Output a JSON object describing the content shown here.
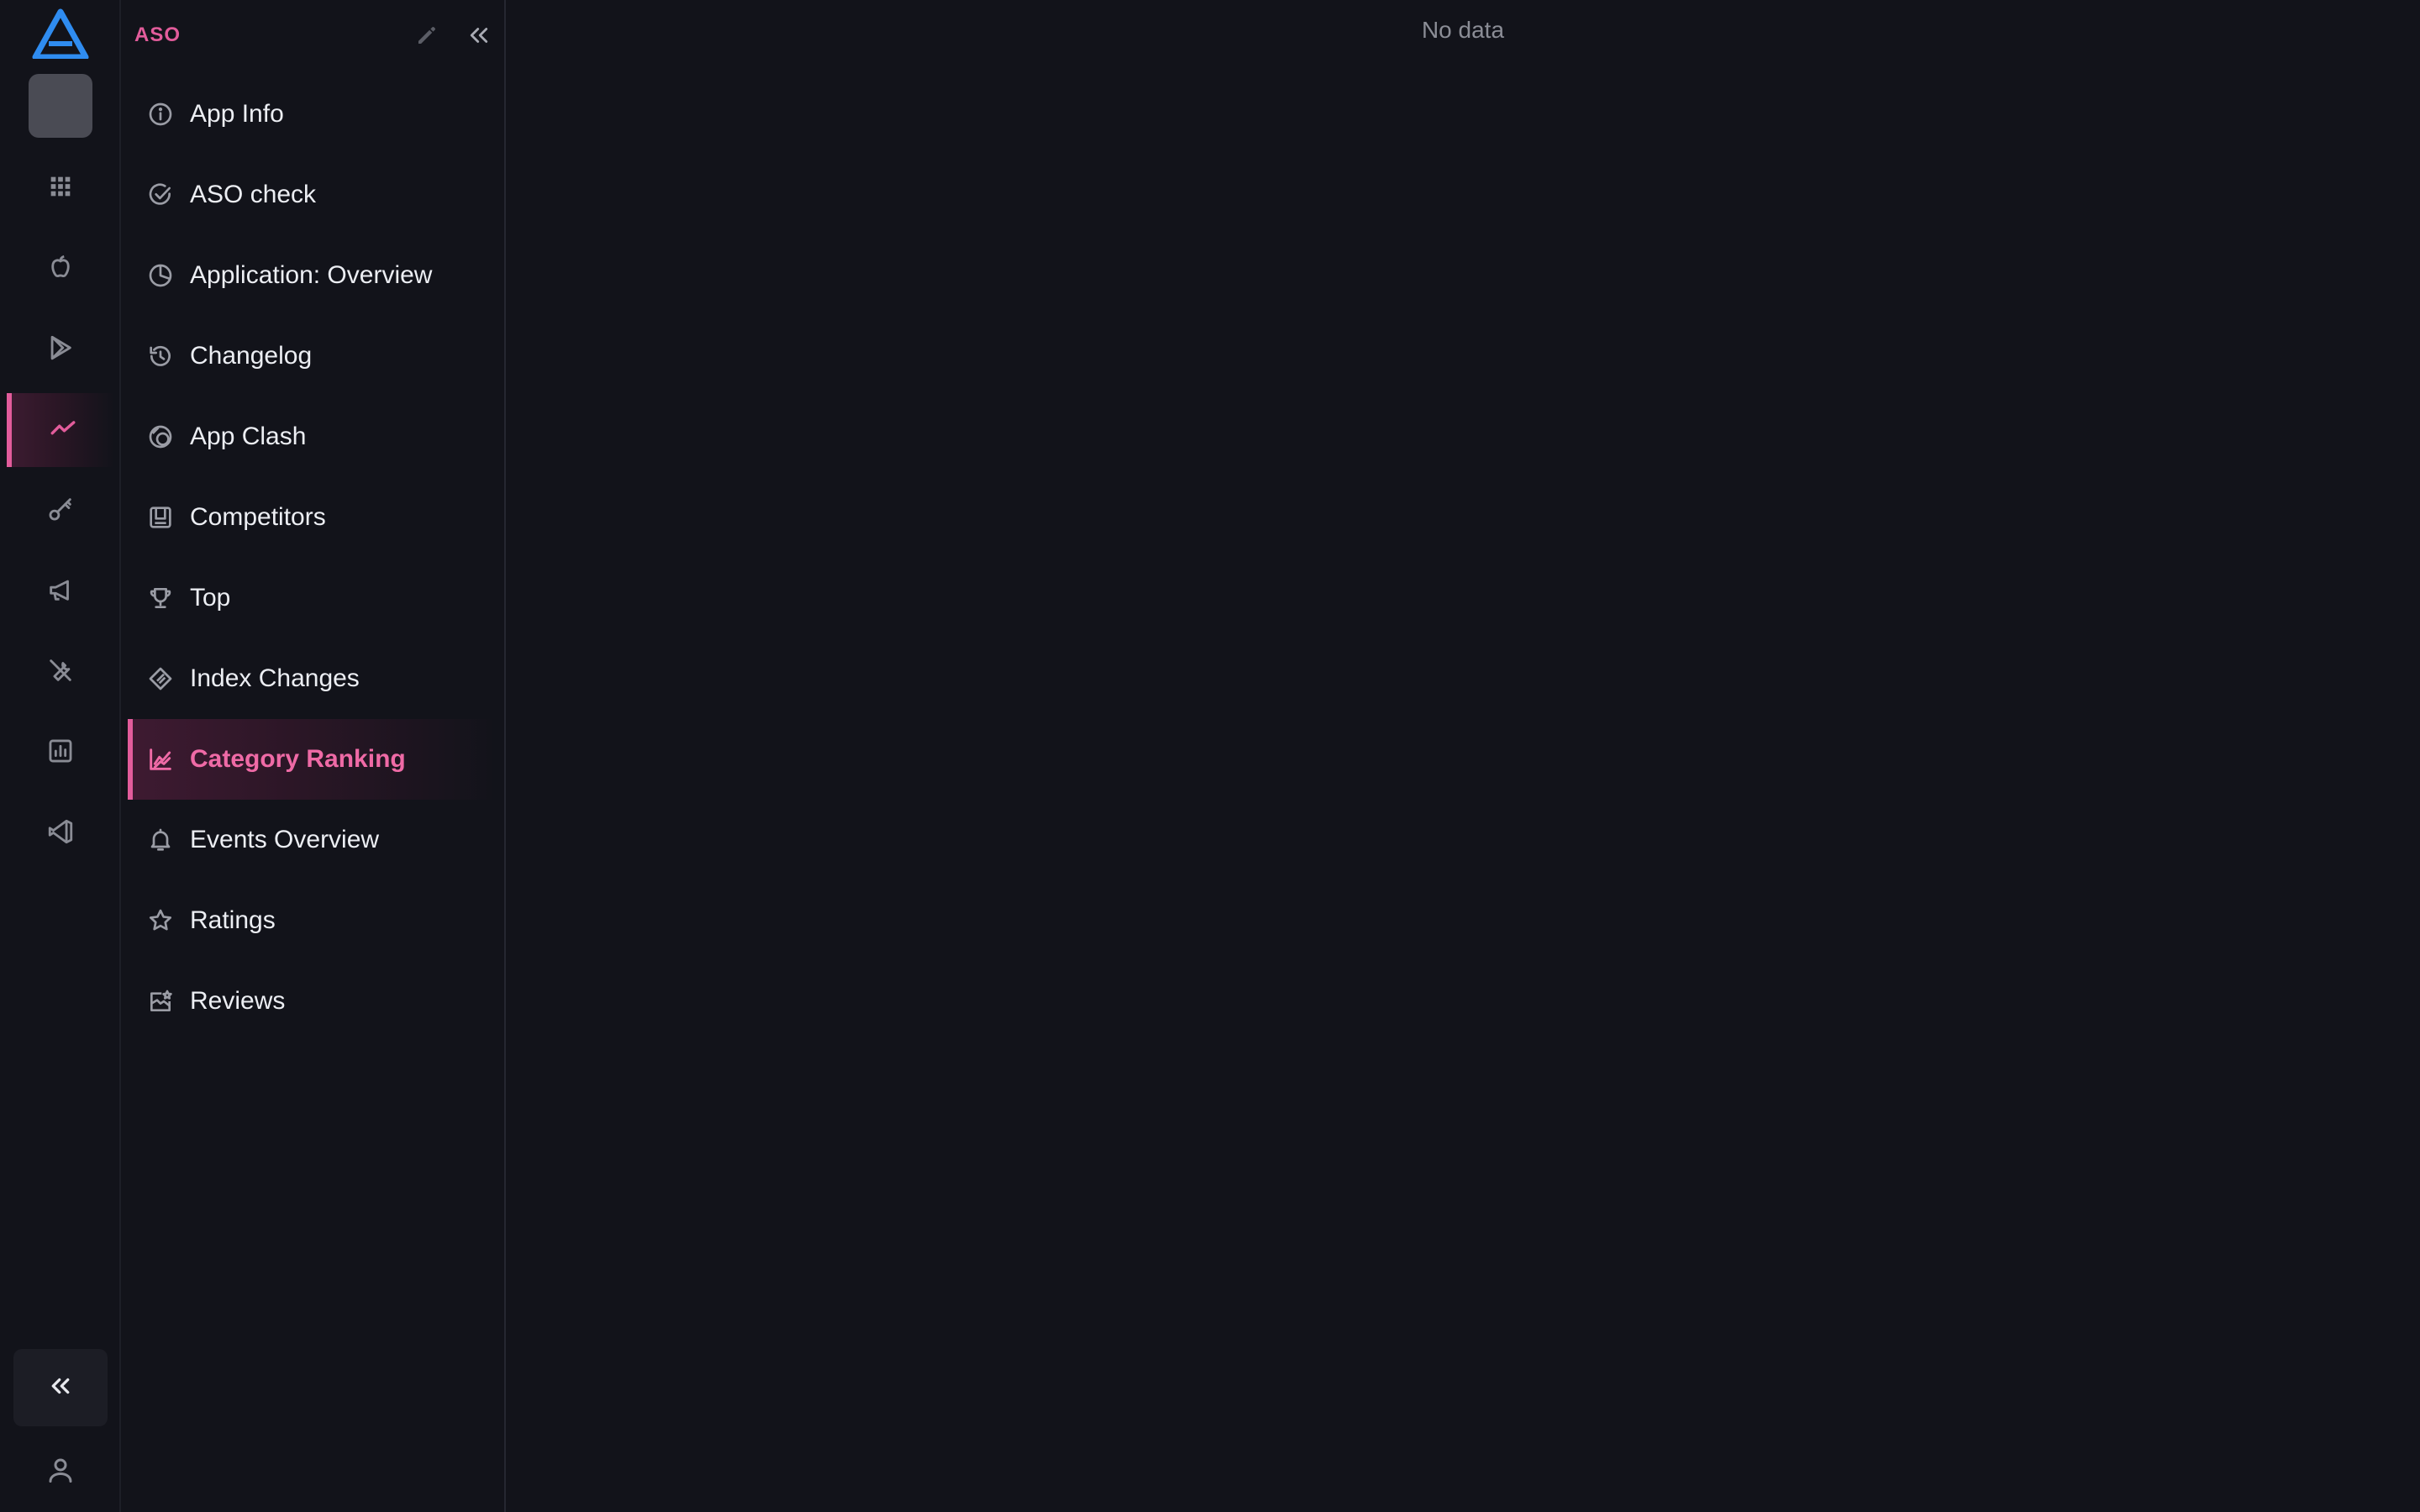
{
  "colors": {
    "accent": "#e25c9b",
    "background": "#12131a",
    "logo": "#2f8cf0",
    "icon": "#8a8c95",
    "text": "#eceef3",
    "muted_text": "#8b8d96"
  },
  "rail": {
    "logo_icon": "app-logo-icon",
    "items": [
      {
        "name": "apps-grid-icon",
        "active": false
      },
      {
        "name": "apple-icon",
        "active": false
      },
      {
        "name": "google-play-icon",
        "active": false
      },
      {
        "name": "trending-chart-icon",
        "active": true
      },
      {
        "name": "key-icon",
        "active": false
      },
      {
        "name": "megaphone-icon",
        "active": false
      },
      {
        "name": "wrench-icon",
        "active": false
      },
      {
        "name": "bar-chart-icon",
        "active": false
      },
      {
        "name": "code-editor-icon",
        "active": false
      }
    ],
    "collapse_icon": "chevrons-left-icon",
    "user_icon": "user-icon"
  },
  "sidebar": {
    "title": "ASO",
    "items": [
      {
        "label": "App Info",
        "icon": "info-circle-icon",
        "active": false
      },
      {
        "label": "ASO check",
        "icon": "check-circle-icon",
        "active": false
      },
      {
        "label": "Application: Overview",
        "icon": "pie-chart-icon",
        "active": false
      },
      {
        "label": "Changelog",
        "icon": "history-icon",
        "active": false
      },
      {
        "label": "App Clash",
        "icon": "clash-circles-icon",
        "active": false
      },
      {
        "label": "Competitors",
        "icon": "competitors-icon",
        "active": false
      },
      {
        "label": "Top",
        "icon": "trophy-icon",
        "active": false
      },
      {
        "label": "Index Changes",
        "icon": "index-tag-icon",
        "active": false
      },
      {
        "label": "Category Ranking",
        "icon": "line-chart-icon",
        "active": true
      },
      {
        "label": "Events Overview",
        "icon": "bell-icon",
        "active": false
      },
      {
        "label": "Ratings",
        "icon": "star-icon",
        "active": false
      },
      {
        "label": "Reviews",
        "icon": "reviews-icon",
        "active": false
      }
    ]
  },
  "main": {
    "empty_text": "No data"
  }
}
